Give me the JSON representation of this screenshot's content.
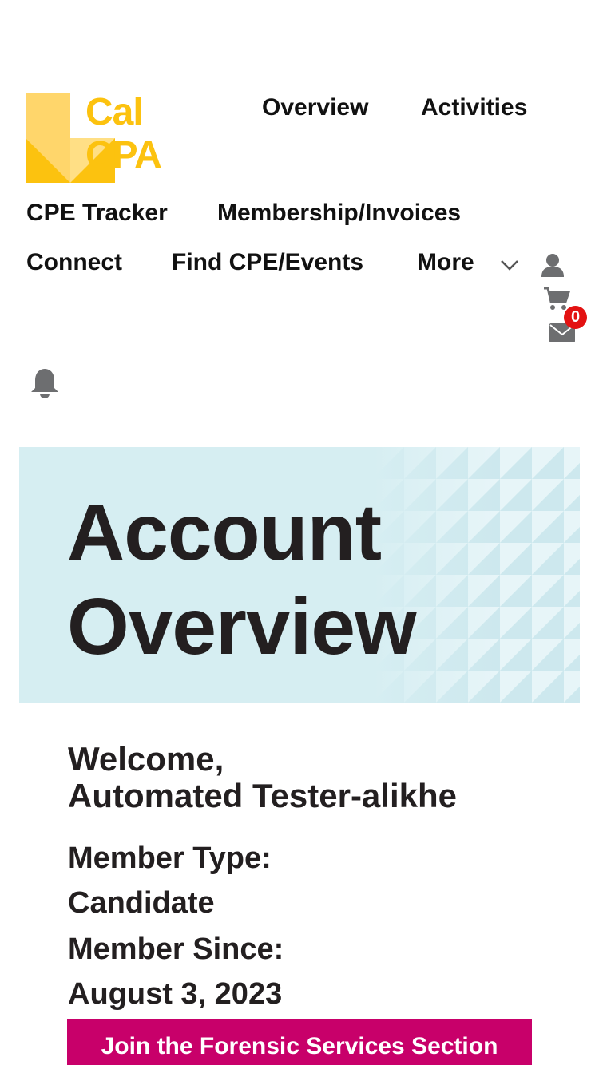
{
  "brand": {
    "logo_line1": "Cal",
    "logo_line2": "CPA",
    "logo_color": "#fcc20f"
  },
  "nav": {
    "overview": "Overview",
    "activities": "Activities",
    "cpe_tracker": "CPE Tracker",
    "membership": "Membership/Invoices",
    "connect": "Connect",
    "find_cpe": "Find CPE/Events",
    "more": "More"
  },
  "cart": {
    "count": "0"
  },
  "icons": [
    "user-icon",
    "cart-icon",
    "mail-icon",
    "bell-icon",
    "chevron-down-icon"
  ],
  "hero": {
    "title_line1": "Account",
    "title_line2": "Overview"
  },
  "welcome": {
    "greeting": "Welcome,",
    "name": "Automated Tester-alikhe"
  },
  "member": {
    "type_label": "Member Type:",
    "type_value": "Candidate",
    "since_label": "Member Since:",
    "since_value": "August 3, 2023"
  },
  "cta": {
    "join_label": "Join the Forensic Services Section"
  },
  "colors": {
    "accent": "#c8006a",
    "hero_bg": "#d6eef2",
    "badge": "#e31212"
  }
}
